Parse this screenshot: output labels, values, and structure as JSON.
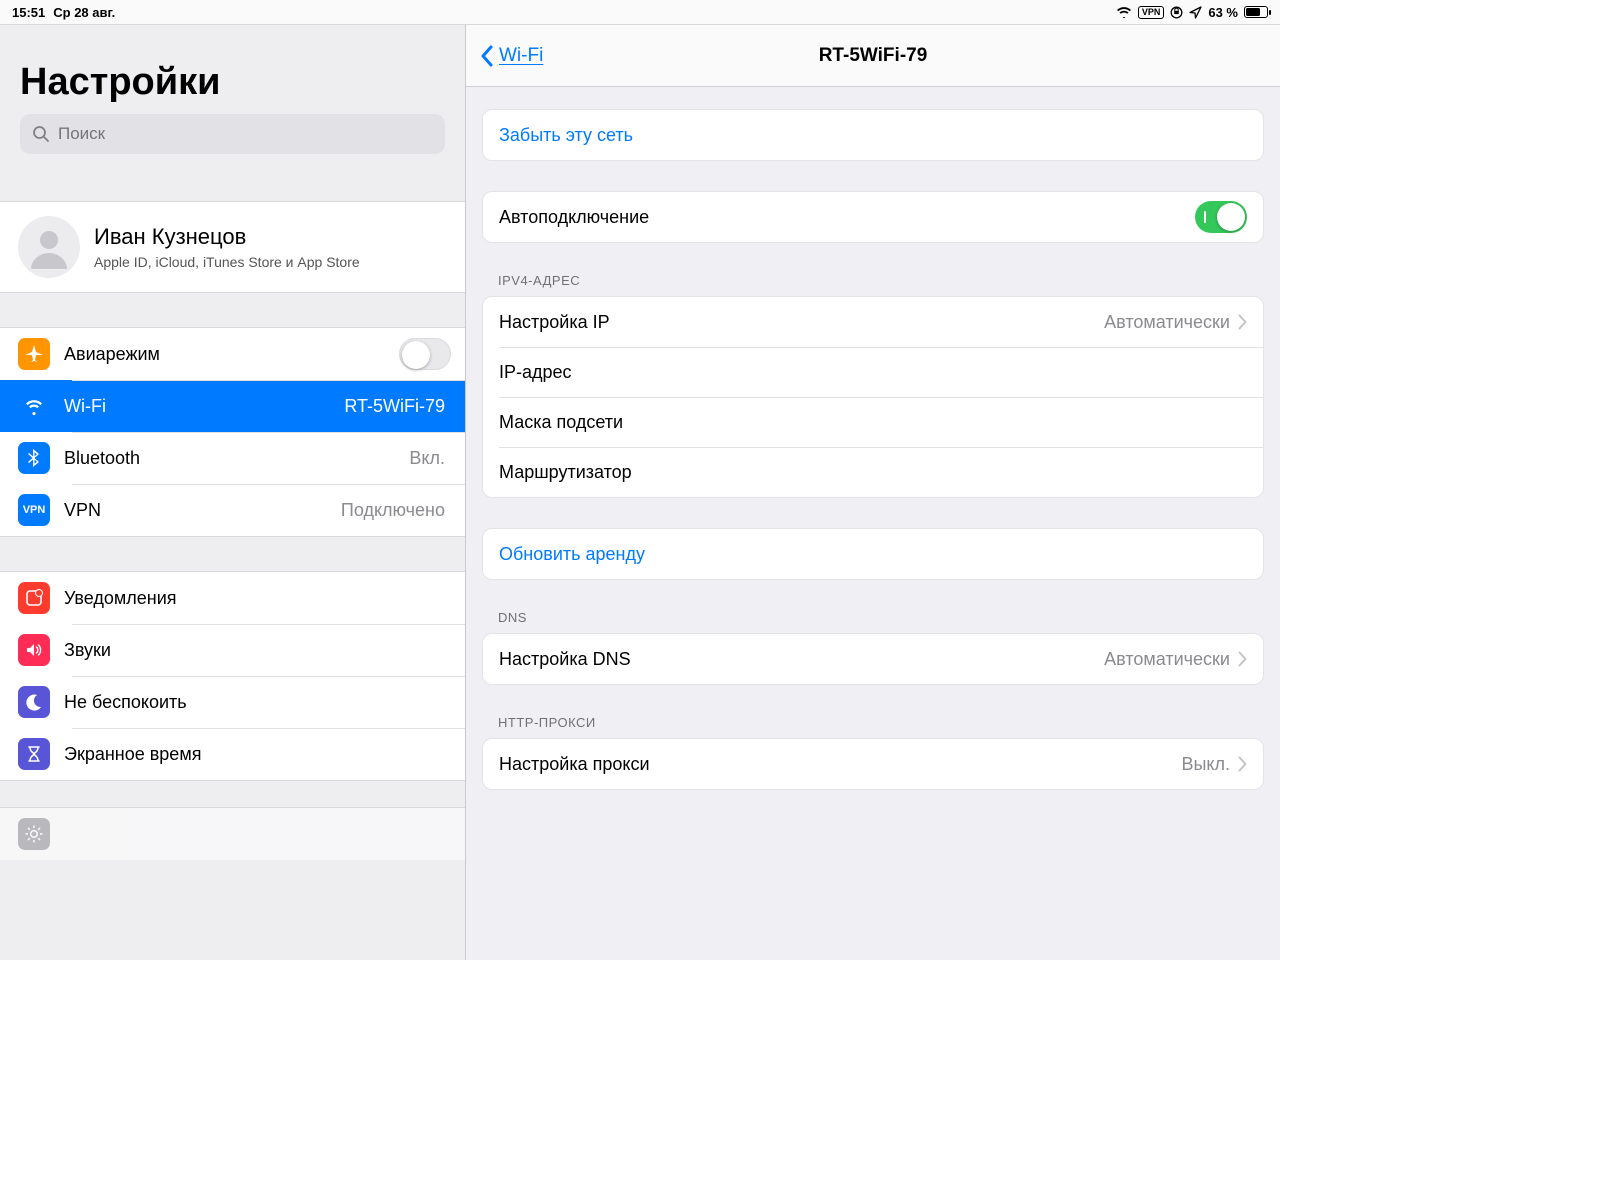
{
  "statusbar": {
    "time": "15:51",
    "date": "Ср 28 авг.",
    "vpn_label": "VPN",
    "battery_text": "63 %",
    "battery_pct": 63
  },
  "sidebar": {
    "title": "Настройки",
    "search_placeholder": "Поиск",
    "user": {
      "name": "Иван Кузнецов",
      "subtitle": "Apple ID, iCloud, iTunes Store и App Store"
    },
    "g1": {
      "airplane": {
        "label": "Авиарежим",
        "on": false
      },
      "wifi": {
        "label": "Wi-Fi",
        "value": "RT-5WiFi-79"
      },
      "bluetooth": {
        "label": "Bluetooth",
        "value": "Вкл."
      },
      "vpn": {
        "label": "VPN",
        "value": "Подключено"
      }
    },
    "g2": {
      "notifications": {
        "label": "Уведомления"
      },
      "sounds": {
        "label": "Звуки"
      },
      "dnd": {
        "label": "Не беспокоить"
      },
      "screentime": {
        "label": "Экранное время"
      }
    }
  },
  "detail": {
    "nav": {
      "back": "Wi-Fi",
      "title": "RT-5WiFi-79"
    },
    "forget": "Забыть эту сеть",
    "autojoin": {
      "label": "Автоподключение",
      "on": true
    },
    "ipv4_header": "IPV4-АДРЕС",
    "ipv4": {
      "configure_label": "Настройка IP",
      "configure_value": "Автоматически",
      "ip_label": "IP-адрес",
      "mask_label": "Маска подсети",
      "router_label": "Маршрутизатор"
    },
    "renew": "Обновить аренду",
    "dns_header": "DNS",
    "dns": {
      "configure_label": "Настройка DNS",
      "configure_value": "Автоматически"
    },
    "proxy_header": "HTTP-ПРОКСИ",
    "proxy": {
      "configure_label": "Настройка прокси",
      "configure_value": "Выкл."
    }
  }
}
